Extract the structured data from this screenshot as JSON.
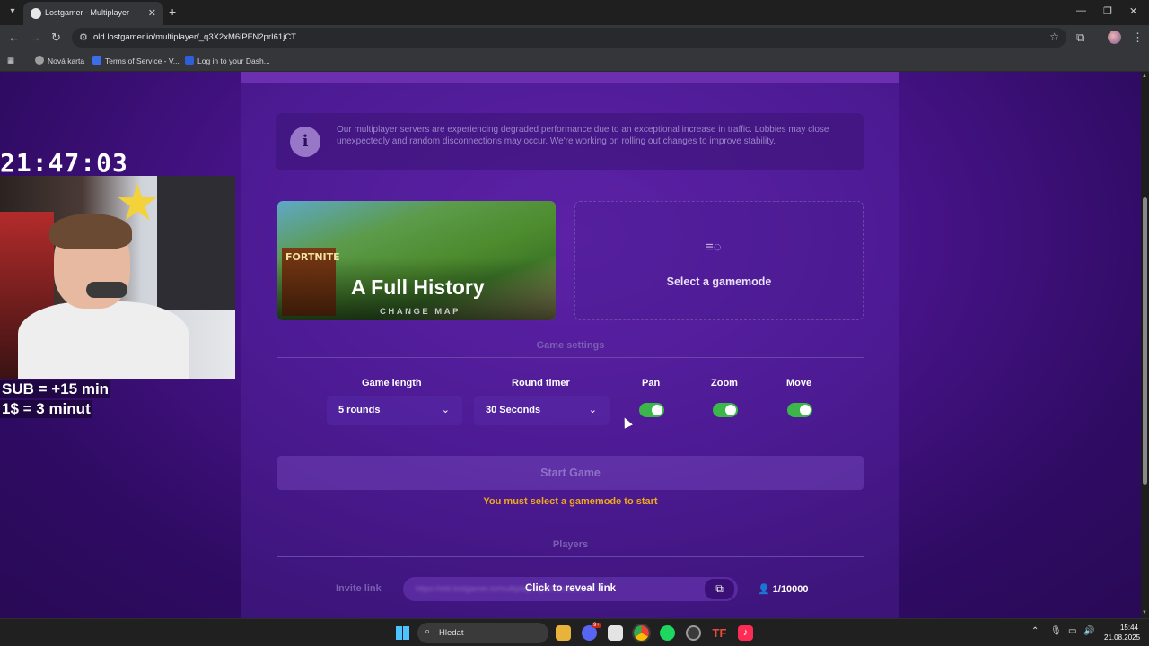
{
  "browser": {
    "tab_title": "Lostgamer - Multiplayer",
    "tab_close": "✕",
    "new_tab": "+",
    "url": "old.lostgamer.io/multiplayer/_q3X2xM6iPFN2prI61jCT",
    "bookmarks": [
      {
        "label": "Nová karta",
        "color": "#9e9e9e"
      },
      {
        "label": "Terms of Service - V...",
        "color": "#3b6ee8"
      },
      {
        "label": "Log in to your Dash...",
        "color": "#2c5fd9"
      }
    ]
  },
  "overlay": {
    "clock": "21:47:03",
    "sub_line1": "SUB = +15 min",
    "sub_line2": "1$ = 3 minut"
  },
  "notice": {
    "icon": "i",
    "text": "Our multiplayer servers are experiencing degraded performance due to an exceptional increase in traffic. Lobbies may close unexpectedly and random disconnections may occur. We're working on rolling out changes to improve stability."
  },
  "map": {
    "logo_text": "FORTNITE",
    "title": "A Full History",
    "change_label": "CHANGE MAP"
  },
  "gamemode": {
    "label": "Select a gamemode"
  },
  "settings": {
    "section_title": "Game settings",
    "game_length_label": "Game length",
    "game_length_value": "5 rounds",
    "round_timer_label": "Round timer",
    "round_timer_value": "30 Seconds",
    "pan_label": "Pan",
    "zoom_label": "Zoom",
    "move_label": "Move",
    "pan_on": true,
    "zoom_on": true,
    "move_on": true
  },
  "start": {
    "button_label": "Start Game",
    "warning": "You must select a gamemode to start"
  },
  "players": {
    "section_title": "Players",
    "invite_label": "Invite link",
    "reveal_label": "Click to reveal link",
    "player_count": "1/10000"
  },
  "taskbar": {
    "search_label": "Hledat",
    "discord_badge": "9+",
    "time": "15:44",
    "date": "21.08.2025"
  },
  "colors": {
    "accent_purple": "#48148a",
    "toggle_on": "#3cb64a",
    "warning": "#f0a81c"
  }
}
